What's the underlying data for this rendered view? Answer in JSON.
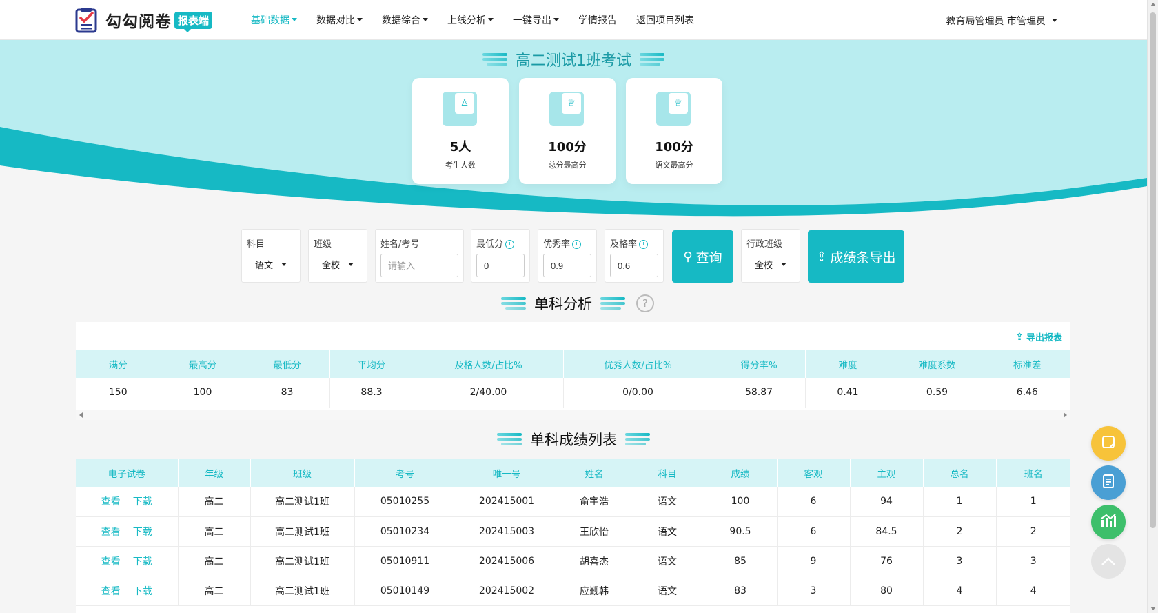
{
  "header": {
    "logo_text": "勾勾阅卷",
    "logo_badge": "报表端",
    "nav": [
      {
        "label": "基础数据",
        "dropdown": true,
        "active": true
      },
      {
        "label": "数据对比",
        "dropdown": true
      },
      {
        "label": "数据综合",
        "dropdown": true
      },
      {
        "label": "上线分析",
        "dropdown": true
      },
      {
        "label": "一键导出",
        "dropdown": true
      },
      {
        "label": "学情报告",
        "dropdown": false
      },
      {
        "label": "返回项目列表",
        "dropdown": false
      }
    ],
    "user": "教育局管理员 市管理员"
  },
  "hero": {
    "exam_title": "高二测试1班考试",
    "cards": [
      {
        "value": "5人",
        "label": "考生人数",
        "icon": "user-icon"
      },
      {
        "value": "100分",
        "label": "总分最高分",
        "icon": "trophy-icon"
      },
      {
        "value": "100分",
        "label": "语文最高分",
        "icon": "trophy-icon"
      }
    ]
  },
  "filters": {
    "subject": {
      "label": "科目",
      "value": "语文"
    },
    "class": {
      "label": "班级",
      "value": "全校"
    },
    "name": {
      "label": "姓名/考号",
      "placeholder": "请输入"
    },
    "min_score": {
      "label": "最低分",
      "value": "0"
    },
    "excellent_rate": {
      "label": "优秀率",
      "value": "0.9"
    },
    "pass_rate": {
      "label": "及格率",
      "value": "0.6"
    },
    "query_button": "查询",
    "admin_class": {
      "label": "行政班级",
      "value": "全校"
    },
    "export_button": "成绩条导出"
  },
  "single_analysis": {
    "title": "单科分析",
    "export_label": "导出报表",
    "headers": [
      "满分",
      "最高分",
      "最低分",
      "平均分",
      "及格人数/占比%",
      "优秀人数/占比%",
      "得分率%",
      "难度",
      "难度系数",
      "标准差"
    ],
    "row": [
      "150",
      "100",
      "83",
      "88.3",
      "2/40.00",
      "0/0.00",
      "58.87",
      "0.41",
      "0.59",
      "6.46"
    ]
  },
  "score_list": {
    "title": "单科成绩列表",
    "headers": [
      "电子试卷",
      "年级",
      "班级",
      "考号",
      "唯一号",
      "姓名",
      "科目",
      "成绩",
      "客观",
      "主观",
      "总名",
      "班名"
    ],
    "view_label": "查看",
    "download_label": "下载",
    "rows": [
      [
        "高二",
        "高二测试1班",
        "05010255",
        "202415001",
        "俞宇浩",
        "语文",
        "100",
        "6",
        "94",
        "1",
        "1"
      ],
      [
        "高二",
        "高二测试1班",
        "05010234",
        "202415003",
        "王欣怡",
        "语文",
        "90.5",
        "6",
        "84.5",
        "2",
        "2"
      ],
      [
        "高二",
        "高二测试1班",
        "05010911",
        "202415006",
        "胡喜杰",
        "语文",
        "85",
        "9",
        "76",
        "3",
        "3"
      ],
      [
        "高二",
        "高二测试1班",
        "05010149",
        "202415002",
        "应觐韩",
        "语文",
        "83",
        "3",
        "80",
        "4",
        "4"
      ]
    ]
  },
  "fabs": [
    {
      "icon": "note-icon",
      "color": "#f7c33a"
    },
    {
      "icon": "document-icon",
      "color": "#4a9fd4"
    },
    {
      "icon": "chart-icon",
      "color": "#3dbf6b"
    },
    {
      "icon": "back-to-top-icon",
      "color": "#e4e4e4"
    }
  ]
}
